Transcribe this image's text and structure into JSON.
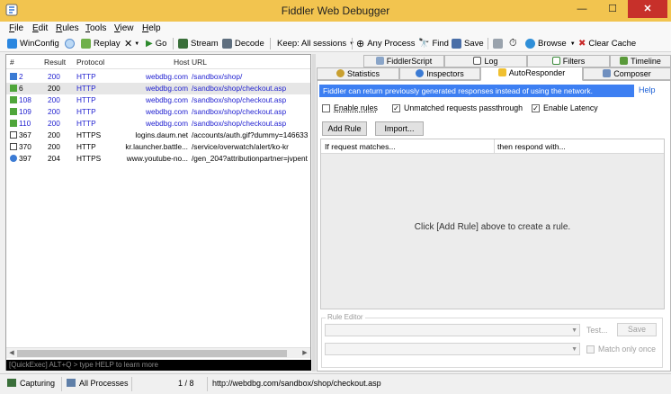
{
  "window": {
    "title": "Fiddler Web Debugger",
    "minimize": "—",
    "maximize": "☐",
    "close": "✕"
  },
  "menu": {
    "items": [
      {
        "key": "F",
        "rest": "ile"
      },
      {
        "key": "E",
        "rest": "dit"
      },
      {
        "key": "R",
        "rest": "ules"
      },
      {
        "key": "T",
        "rest": "ools"
      },
      {
        "key": "V",
        "rest": "iew"
      },
      {
        "key": "H",
        "rest": "elp"
      }
    ]
  },
  "toolbar": {
    "winconfig": "WinConfig",
    "replay": "Replay",
    "remove": "✕",
    "go": "Go",
    "stream": "Stream",
    "decode": "Decode",
    "keep": "Keep: All sessions",
    "any_process": "Any Process",
    "find": "Find",
    "save": "Save",
    "browse": "Browse",
    "clear_cache": "Clear Cache"
  },
  "sessions": {
    "columns": [
      "#",
      "Result",
      "Protocol",
      "Host",
      "URL"
    ],
    "rows": [
      {
        "id": "2",
        "result": "200",
        "protocol": "HTTP",
        "host": "webdbg.com",
        "url": "/sandbox/shop/",
        "blue": true,
        "selected": false,
        "icon": "arrows"
      },
      {
        "id": "6",
        "result": "200",
        "protocol": "HTTP",
        "host": "webdbg.com",
        "url": "/sandbox/shop/checkout.asp",
        "blue": false,
        "selected": true,
        "icon": "arrow-green"
      },
      {
        "id": "108",
        "result": "200",
        "protocol": "HTTP",
        "host": "webdbg.com",
        "url": "/sandbox/shop/checkout.asp",
        "blue": true,
        "selected": false,
        "icon": "arrow-green"
      },
      {
        "id": "109",
        "result": "200",
        "protocol": "HTTP",
        "host": "webdbg.com",
        "url": "/sandbox/shop/checkout.asp",
        "blue": true,
        "selected": false,
        "icon": "arrow-green"
      },
      {
        "id": "110",
        "result": "200",
        "protocol": "HTTP",
        "host": "webdbg.com",
        "url": "/sandbox/shop/checkout.asp",
        "blue": true,
        "selected": false,
        "icon": "arrow-green"
      },
      {
        "id": "367",
        "result": "200",
        "protocol": "HTTPS",
        "host": "logins.daum.net",
        "url": "/accounts/auth.gif?dummy=146633",
        "blue": false,
        "selected": false,
        "icon": "doc"
      },
      {
        "id": "370",
        "result": "200",
        "protocol": "HTTP",
        "host": "kr.launcher.battle...",
        "url": "/service/overwatch/alert/ko-kr",
        "blue": false,
        "selected": false,
        "icon": "doc"
      },
      {
        "id": "397",
        "result": "204",
        "protocol": "HTTPS",
        "host": "www.youtube-no...",
        "url": "/gen_204?attributionpartner=jvpent",
        "blue": false,
        "selected": false,
        "icon": "info"
      }
    ]
  },
  "quickexec": "[QuickExec] ALT+Q > type HELP to learn more",
  "tabs": {
    "row1": [
      "FiddlerScript",
      "Log",
      "Filters",
      "Timeline"
    ],
    "row2": [
      "Statistics",
      "Inspectors",
      "AutoResponder",
      "Composer"
    ],
    "active": "AutoResponder"
  },
  "autoresponder": {
    "banner": "Fiddler can return previously generated responses instead of using the network.",
    "help": "Help",
    "enable_rules": "Enable rules",
    "unmatched": "Unmatched requests passthrough",
    "latency": "Enable Latency",
    "enable_rules_checked": false,
    "unmatched_checked": true,
    "latency_checked": true,
    "add_rule": "Add Rule",
    "import": "Import...",
    "col_match": "If request matches...",
    "col_respond": "then respond with...",
    "empty_text": "Click [Add Rule] above to create a rule.",
    "rule_editor": "Rule Editor",
    "test": "Test...",
    "save": "Save",
    "match_only_once": "Match only once"
  },
  "status": {
    "capturing": "Capturing",
    "processes": "All Processes",
    "count": "1 / 8",
    "url": "http://webdbg.com/sandbox/shop/checkout.asp"
  },
  "colors": {
    "title_bar": "#f2c44f",
    "banner": "#3d7ff2",
    "link_blue": "#1f1fd0",
    "close": "#c7302a"
  }
}
